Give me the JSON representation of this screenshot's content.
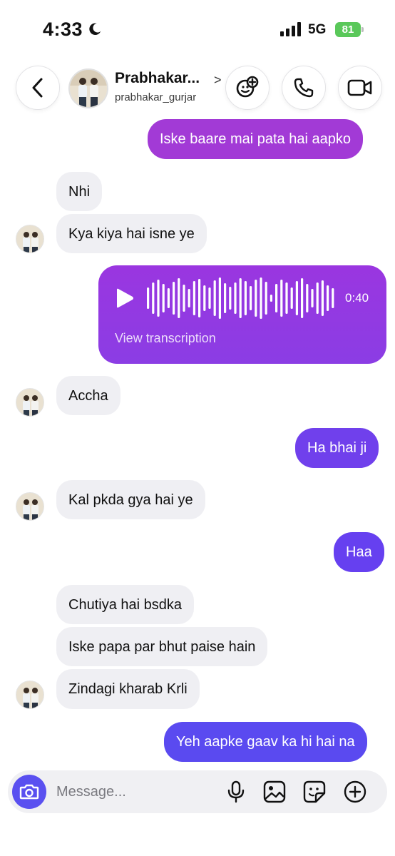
{
  "status_bar": {
    "time": "4:33",
    "network": "5G",
    "battery": "81"
  },
  "header": {
    "name": "Prabhakar...",
    "username": "prabhakar_gurjar",
    "chevron": ">"
  },
  "messages": [
    {
      "side": "out",
      "text": "Iske baare mai pata hai aapko"
    },
    {
      "side": "in",
      "text": "Nhi"
    },
    {
      "side": "in",
      "text": "Kya kiya hai isne ye"
    },
    {
      "side": "out",
      "type": "voice",
      "duration": "0:40",
      "transcription_label": "View transcription"
    },
    {
      "side": "in",
      "text": "Accha"
    },
    {
      "side": "out",
      "text": "Ha bhai ji"
    },
    {
      "side": "in",
      "text": "Kal pkda gya hai ye"
    },
    {
      "side": "out",
      "text": "Haa"
    },
    {
      "side": "in",
      "text": "Chutiya hai bsdka"
    },
    {
      "side": "in",
      "text": "Iske papa par bhut paise hain"
    },
    {
      "side": "in",
      "text": "Zindagi kharab Krli"
    },
    {
      "side": "out",
      "text": "Yeh aapke gaav ka hi hai na"
    }
  ],
  "composer": {
    "placeholder": "Message..."
  },
  "colors": {
    "out_top": "#a23ad6",
    "out_mid": "#8b3de4",
    "out_bottom": "#6a3ef0",
    "out_last": "#5a4af0",
    "incoming": "#efeff3",
    "camera": "#5a50f0",
    "battery": "#5ac85a"
  },
  "icons": [
    "back-arrow-icon",
    "emoji-add-icon",
    "phone-icon",
    "video-camera-icon",
    "play-icon",
    "waveform-icon",
    "camera-icon",
    "microphone-icon",
    "gallery-icon",
    "sticker-icon",
    "plus-icon",
    "moon-icon",
    "signal-icon"
  ]
}
